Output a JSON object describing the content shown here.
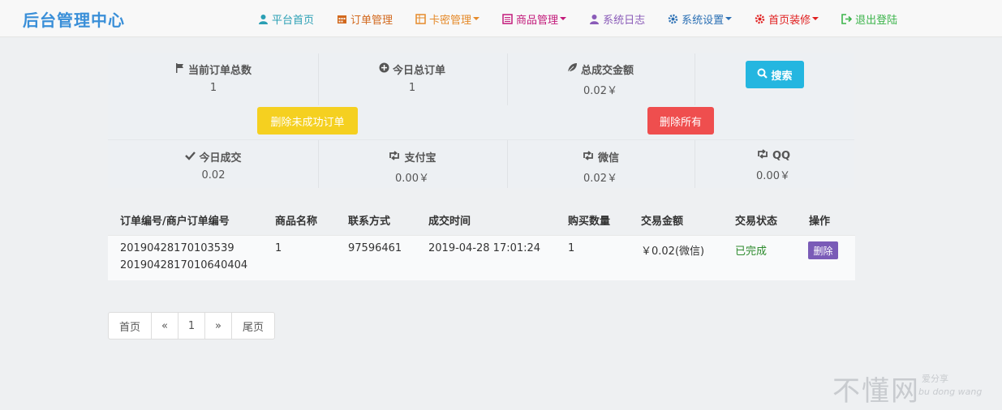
{
  "app": {
    "brand": "后台管理中心"
  },
  "nav": {
    "items": [
      {
        "label": "平台首页",
        "icon": "user-icon",
        "color": "#2a9fb4"
      },
      {
        "label": "订单管理",
        "icon": "calendar-icon",
        "color": "#d2691e"
      },
      {
        "label": "卡密管理",
        "icon": "grid-icon",
        "color": "#e58a2a"
      },
      {
        "label": "商品管理",
        "icon": "list-icon",
        "color": "#c21a7a"
      },
      {
        "label": "系统日志",
        "icon": "user-icon",
        "color": "#8a5bb8"
      },
      {
        "label": "系统设置",
        "icon": "gear-icon",
        "color": "#2a6fb4"
      },
      {
        "label": "首页装修",
        "icon": "gear-icon",
        "color": "#e02020"
      },
      {
        "label": "退出登陆",
        "icon": "logout-icon",
        "color": "#3cb44b"
      }
    ]
  },
  "stats": {
    "total_orders_label": "当前订单总数",
    "total_orders_value": "1",
    "today_orders_label": "今日总订单",
    "today_orders_value": "1",
    "total_amount_label": "总成交金额",
    "total_amount_value": "0.02￥",
    "today_deal_label": "今日成交",
    "today_deal_value": "0.02",
    "alipay_label": "支付宝",
    "alipay_value": "0.00￥",
    "wechat_label": "微信",
    "wechat_value": "0.02￥",
    "qq_label": "QQ",
    "qq_value": "0.00￥"
  },
  "actions": {
    "search_label": "搜索",
    "delete_unsuccessful_label": "删除未成功订单",
    "delete_all_label": "删除所有"
  },
  "table": {
    "headers": [
      "订单编号/商户订单编号",
      "商品名称",
      "联系方式",
      "成交时间",
      "购买数量",
      "交易金额",
      "交易状态",
      "操作"
    ],
    "rows": [
      {
        "order_no": "20190428170103539",
        "merchant_no": "2019042817010640404",
        "product": "1",
        "contact": "97596461",
        "time": "2019-04-28 17:01:24",
        "qty": "1",
        "amount": "￥0.02(微信)",
        "status": "已完成",
        "action": "删除"
      }
    ]
  },
  "pagination": {
    "first": "首页",
    "prev": "«",
    "page": "1",
    "next": "»",
    "last": "尾页"
  },
  "watermark": {
    "big": "不懂网",
    "small1": "爱分享",
    "small2": "bu dong wang"
  }
}
